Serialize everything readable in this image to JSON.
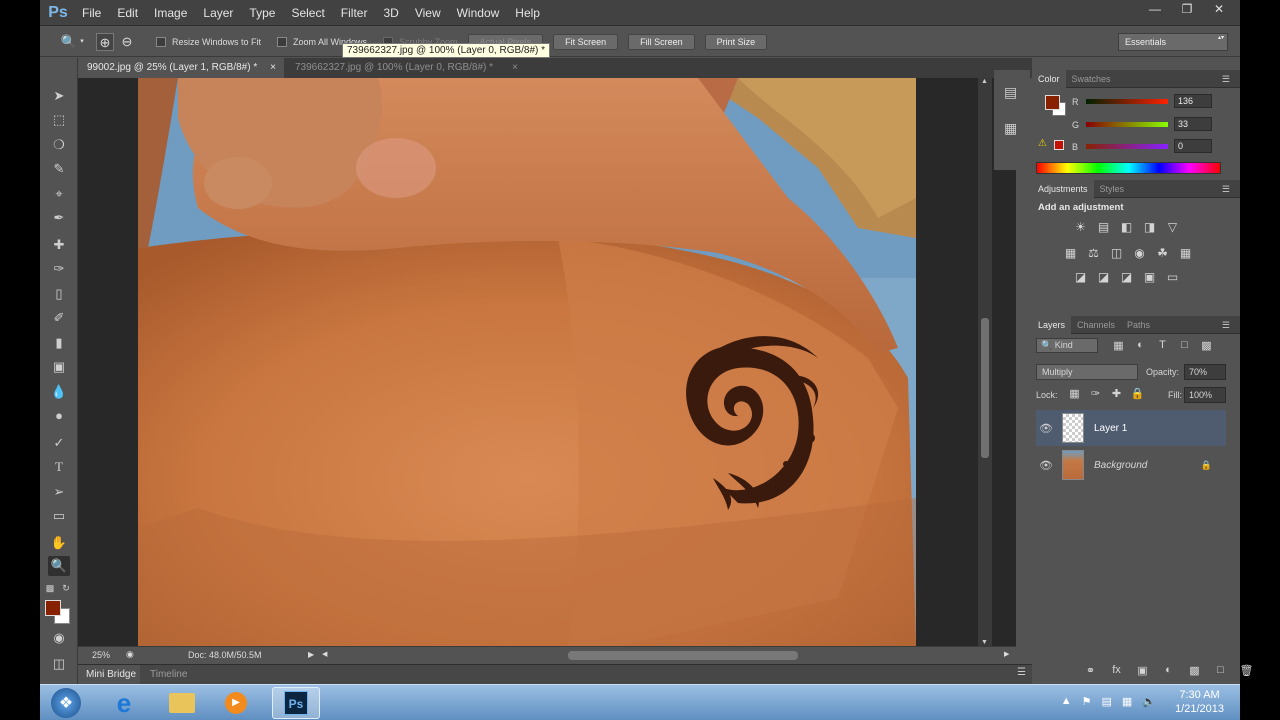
{
  "app": {
    "logo": "Ps"
  },
  "menu": [
    "File",
    "Edit",
    "Image",
    "Layer",
    "Type",
    "Select",
    "Filter",
    "3D",
    "View",
    "Window",
    "Help"
  ],
  "window_controls": {
    "minimize": "—",
    "restore": "❐",
    "close": "✕"
  },
  "options": {
    "resize_windows": "Resize Windows to Fit",
    "zoom_all_windows": "Zoom All Windows",
    "scrubby_zoom": "Scrubby Zoom",
    "actual_pixels": "Actual Pixels",
    "fit_screen": "Fit Screen",
    "fill_screen": "Fill Screen",
    "print_size": "Print Size",
    "workspace": "Essentials"
  },
  "tooltip": "739662327.jpg @ 100% (Layer 0, RGB/8#) *",
  "tabs": [
    {
      "label": "99002.jpg @ 25% (Layer 1, RGB/8#) *",
      "close": "×"
    },
    {
      "label": "739662327.jpg @ 100% (Layer 0, RGB/8#) *",
      "close": "×"
    }
  ],
  "status": {
    "zoom": "25%",
    "doc": "Doc: 48.0M/50.5M"
  },
  "bottom_tabs": {
    "mini_bridge": "Mini Bridge",
    "timeline": "Timeline"
  },
  "color_panel": {
    "tabs": [
      "Color",
      "Swatches"
    ],
    "r_label": "R",
    "g_label": "G",
    "b_label": "B",
    "r": "136",
    "g": "33",
    "b": "0",
    "fg_color": "#882100"
  },
  "adjustments": {
    "tabs": [
      "Adjustments",
      "Styles"
    ],
    "heading": "Add an adjustment"
  },
  "layers_panel": {
    "tabs": [
      "Layers",
      "Channels",
      "Paths"
    ],
    "kind": "Kind",
    "blend_mode": "Multiply",
    "opacity_label": "Opacity:",
    "opacity": "70%",
    "lock_label": "Lock:",
    "fill_label": "Fill:",
    "fill": "100%",
    "layers": [
      {
        "name": "Layer 1",
        "selected": true
      },
      {
        "name": "Background",
        "selected": false
      }
    ]
  },
  "taskbar": {
    "time": "7:30 AM",
    "date": "1/21/2013"
  },
  "colors": {
    "accent": "#4f5c70",
    "panel": "#535353",
    "fg_swatch": "#882100"
  }
}
